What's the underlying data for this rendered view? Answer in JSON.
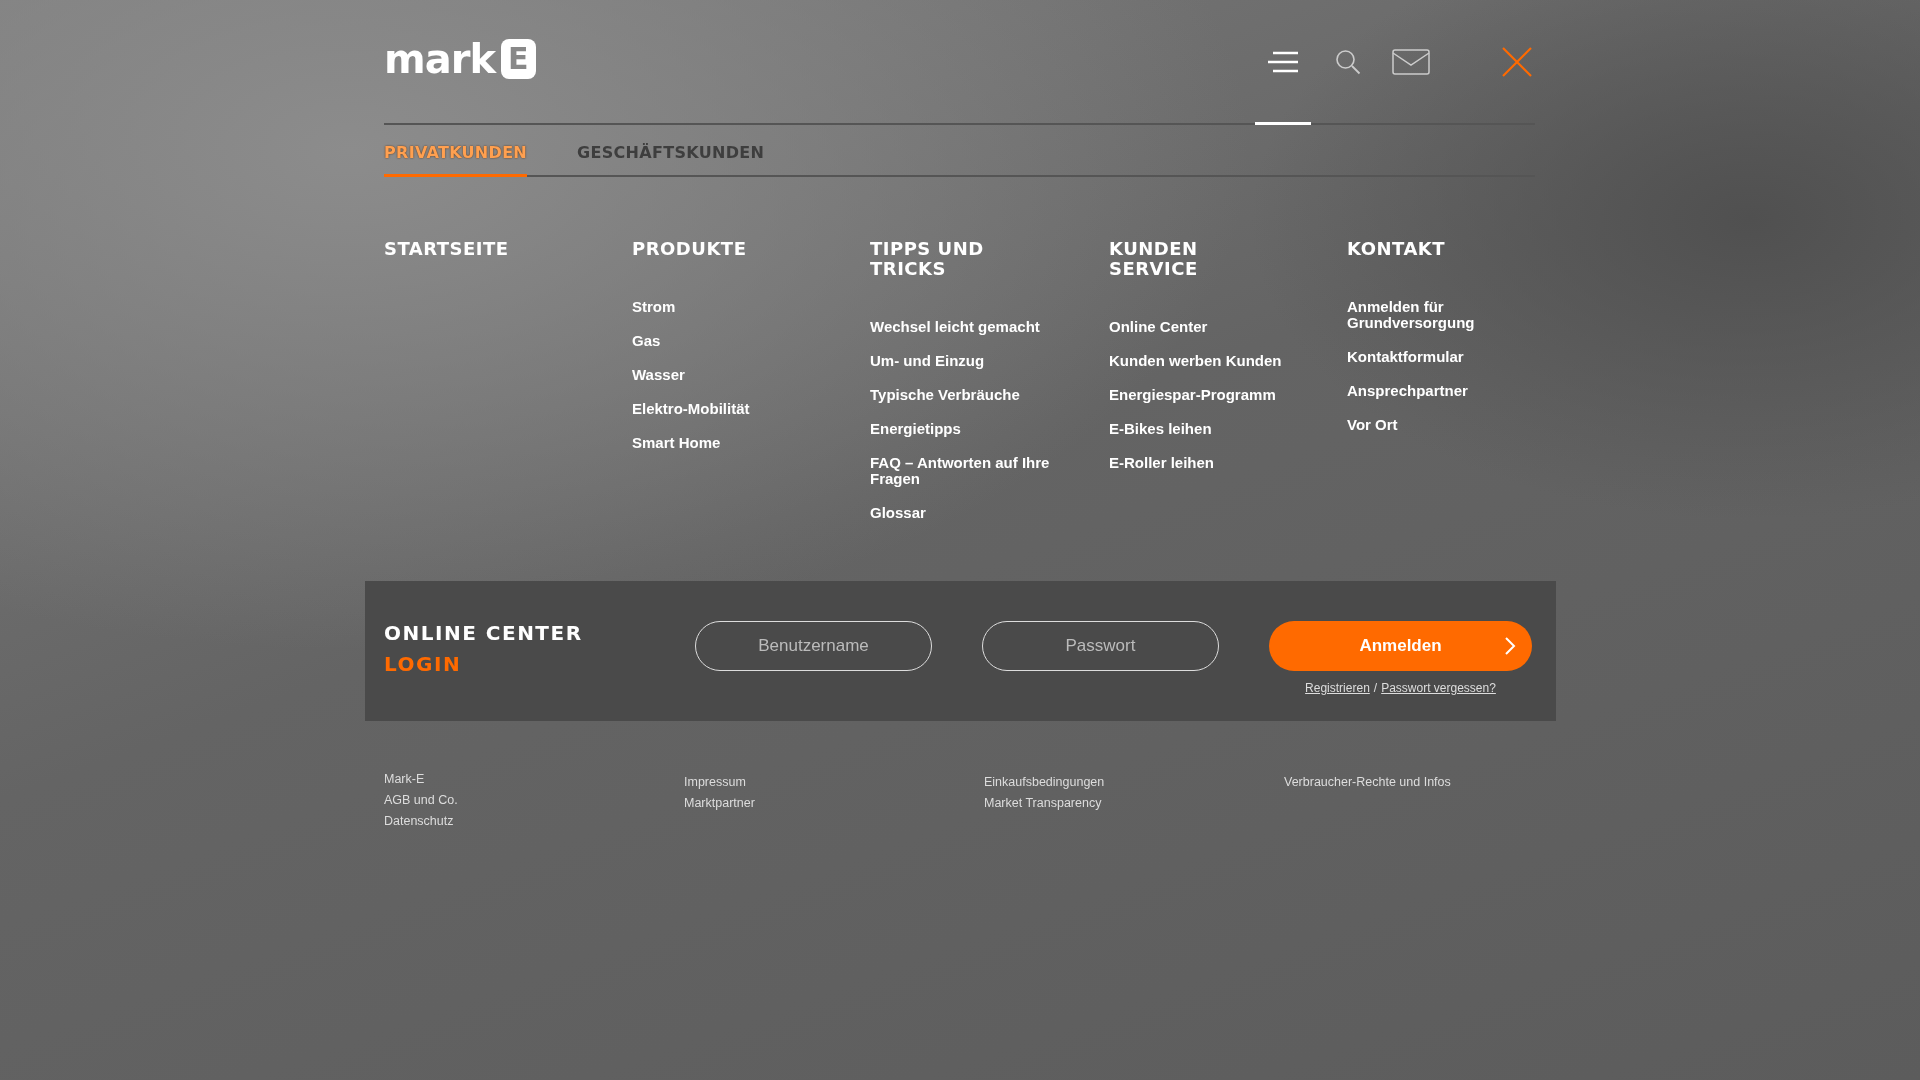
{
  "logo": {
    "word": "mark",
    "letter": "E"
  },
  "header_icons": [
    {
      "kind": "menu",
      "selected": true
    },
    {
      "kind": "search",
      "selected": false
    },
    {
      "kind": "mail",
      "selected": false
    },
    {
      "kind": "close",
      "selected": false
    }
  ],
  "tabs": [
    {
      "label": "PRIVATKUNDEN",
      "selected": true
    },
    {
      "label": "GESCHÄFTSKUNDEN",
      "selected": false
    }
  ],
  "menu_columns": [
    {
      "heading": "STARTSEITE"
    },
    {
      "heading": "PRODUKTE",
      "links": [
        "Strom",
        "Gas",
        "Wasser",
        "Elektro-Mobilität",
        "Smart Home"
      ]
    },
    {
      "heading": "TIPPS UND TRICKS",
      "links": [
        "Wechsel leicht gemacht",
        "Um- und Einzug",
        "Typische Verbräuche",
        "Energietipps",
        "FAQ – Antworten auf Ihre Fragen",
        "Glossar"
      ]
    },
    {
      "heading": "KUNDEN SERVICE",
      "links": [
        "Online Center",
        "Kunden werben Kunden",
        "Energiespar-Programm",
        "E-Bikes leihen",
        "E-Roller leihen"
      ]
    },
    {
      "heading": "KONTAKT",
      "links": [
        "Anmelden für Grundversorgung",
        "Kontaktformular",
        "Ansprechpartner",
        "Vor Ort"
      ]
    }
  ],
  "login": {
    "title": "ONLINE CENTER",
    "subtitle": "LOGIN",
    "username_placeholder": "Benutzername",
    "password_placeholder": "Passwort",
    "submit": "Anmelden",
    "register_link": "Registrieren",
    "separator": "/",
    "forgot_link": "Passwort vergessen?"
  },
  "footer_columns": [
    [
      "Mark-E",
      "AGB und Co.",
      "Datenschutz"
    ],
    [
      "Impressum",
      "Marktpartner"
    ],
    [
      "Einkaufsbedingungen",
      "Market Transparency"
    ],
    [
      "Verbraucher-Rechte und Infos"
    ]
  ]
}
